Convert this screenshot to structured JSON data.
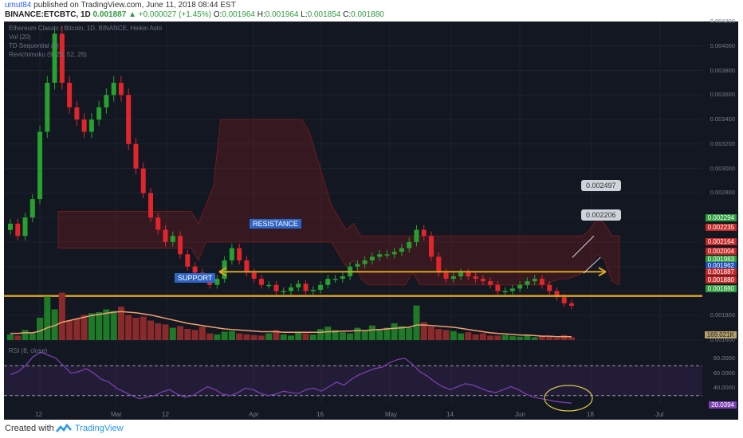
{
  "header": {
    "user": "umut84",
    "published": "published on TradingView.com, June 11, 2018 08:44 EST",
    "symbol": "BINANCE:ETCBTC, 1D",
    "price": "0.001887",
    "change": "▲ +0.000027 (+1.45%)",
    "o_label": "O:",
    "o": "0.001964",
    "h_label": "H:",
    "h": "0.001964",
    "l_label": "L:",
    "l": "0.001854",
    "c_label": "C:",
    "c": "0.001880"
  },
  "indicators": {
    "title": "Ethereum Classic / Bitcoin, 1D, BINANCE, Heikin Ashi",
    "vol": "Vol (20)",
    "td": "TD Sequential (0)",
    "ichimoku": "Revichimoku (9, 26, 52, 26)",
    "rsi": "RSI (8, close)"
  },
  "annotations": {
    "resistance": "RESISTANCE",
    "support": "SUPPORT",
    "callout1": "0.002497",
    "callout2": "0.002206"
  },
  "axis": {
    "price_labels": [
      "0.004200",
      "0.004000",
      "0.003800",
      "0.003600",
      "0.003400",
      "0.003200",
      "0.003000",
      "0.002800",
      "0.002600",
      "0.002400",
      "0.002200",
      "0.002000",
      "0.001800",
      "0.001600"
    ],
    "x_labels": [
      "12",
      "Mar",
      "12",
      "Apr",
      "16",
      "May",
      "14",
      "Jun",
      "18",
      "Jul"
    ],
    "rsi_labels": [
      "80.0000",
      "60.0000",
      "40.0000"
    ]
  },
  "price_tags": [
    {
      "text": "0.002294",
      "color": "#2e9e3e"
    },
    {
      "text": "0.002235",
      "color": "#c62828"
    },
    {
      "text": "0.002164",
      "color": "#c62828"
    },
    {
      "text": "0.002004",
      "color": "#c62828"
    },
    {
      "text": "0.001983",
      "color": "#2e9e3e"
    },
    {
      "text": "0.001962",
      "color": "#1e4fb5"
    },
    {
      "text": "0.001887",
      "color": "#c62828"
    },
    {
      "text": "0.001880",
      "color": "#c62828"
    },
    {
      "text": "0.001880",
      "color": "#2e9e3e"
    }
  ],
  "volume_tag": "169.021K",
  "rsi_tag": "20.0394",
  "footer": {
    "created_with": "Created with",
    "brand": "TradingView"
  },
  "colors": {
    "up": "#26a12f",
    "down": "#e0252b",
    "background": "#131722",
    "support_line": "#d9a21e",
    "rsi_line": "#7b3fb0",
    "volume_ma": "#f0a070"
  },
  "chart_data": {
    "type": "candlestick",
    "title": "Ethereum Classic / Bitcoin, 1D, BINANCE, Heikin Ashi",
    "ylim": [
      0.0016,
      0.0042
    ],
    "x_ticks": [
      "12",
      "Mar",
      "12",
      "Apr",
      "16",
      "May",
      "14",
      "Jun",
      "18",
      "Jul"
    ],
    "close": [
      0.00255,
      0.00245,
      0.0026,
      0.00275,
      0.0033,
      0.0037,
      0.0041,
      0.0037,
      0.0035,
      0.0034,
      0.0033,
      0.0034,
      0.0035,
      0.0036,
      0.0037,
      0.0036,
      0.0032,
      0.003,
      0.0028,
      0.0026,
      0.0025,
      0.0024,
      0.00245,
      0.0023,
      0.0022,
      0.00215,
      0.0021,
      0.00205,
      0.0021,
      0.00225,
      0.00235,
      0.00225,
      0.00215,
      0.0021,
      0.00205,
      0.00205,
      0.002,
      0.002,
      0.00203,
      0.00206,
      0.002,
      0.00201,
      0.00205,
      0.0021,
      0.0021,
      0.00212,
      0.0022,
      0.00222,
      0.00225,
      0.00228,
      0.0023,
      0.0023,
      0.00232,
      0.00235,
      0.0024,
      0.0025,
      0.00245,
      0.00228,
      0.00215,
      0.0021,
      0.00212,
      0.00215,
      0.00212,
      0.0021,
      0.00208,
      0.00205,
      0.002,
      0.002,
      0.00202,
      0.00205,
      0.00208,
      0.0021,
      0.00205,
      0.002,
      0.00195,
      0.0019,
      0.00188
    ],
    "volume_levels": [
      0.1,
      0.08,
      0.18,
      0.12,
      0.4,
      0.78,
      0.55,
      0.85,
      0.35,
      0.38,
      0.45,
      0.48,
      0.5,
      0.55,
      0.52,
      0.6,
      0.45,
      0.4,
      0.42,
      0.35,
      0.3,
      0.28,
      0.22,
      0.25,
      0.2,
      0.18,
      0.24,
      0.12,
      0.1,
      0.15,
      0.16,
      0.12,
      0.1,
      0.09,
      0.08,
      0.12,
      0.18,
      0.1,
      0.08,
      0.14,
      0.12,
      0.1,
      0.2,
      0.24,
      0.18,
      0.14,
      0.12,
      0.22,
      0.16,
      0.26,
      0.2,
      0.22,
      0.3,
      0.25,
      0.22,
      0.62,
      0.32,
      0.24,
      0.2,
      0.18,
      0.16,
      0.12,
      0.14,
      0.1,
      0.12,
      0.08,
      0.08,
      0.09,
      0.07,
      0.06,
      0.08,
      0.05,
      0.07,
      0.06,
      0.04,
      0.09,
      0.05
    ],
    "volume_ma": [
      0.12,
      0.12,
      0.13,
      0.13,
      0.16,
      0.22,
      0.26,
      0.32,
      0.35,
      0.38,
      0.41,
      0.44,
      0.46,
      0.48,
      0.5,
      0.51,
      0.5,
      0.49,
      0.47,
      0.45,
      0.42,
      0.39,
      0.36,
      0.33,
      0.3,
      0.28,
      0.26,
      0.24,
      0.22,
      0.2,
      0.19,
      0.18,
      0.17,
      0.16,
      0.15,
      0.15,
      0.15,
      0.14,
      0.14,
      0.14,
      0.14,
      0.14,
      0.14,
      0.15,
      0.15,
      0.16,
      0.16,
      0.17,
      0.17,
      0.18,
      0.19,
      0.2,
      0.21,
      0.22,
      0.23,
      0.27,
      0.27,
      0.26,
      0.25,
      0.24,
      0.23,
      0.21,
      0.19,
      0.17,
      0.15,
      0.13,
      0.12,
      0.11,
      0.1,
      0.09,
      0.09,
      0.08,
      0.07,
      0.07,
      0.06,
      0.06,
      0.06
    ],
    "rsi": [
      58,
      62,
      70,
      82,
      88,
      84,
      80,
      70,
      60,
      62,
      66,
      60,
      52,
      48,
      40,
      35,
      30,
      26,
      28,
      30,
      35,
      38,
      32,
      28,
      30,
      36,
      42,
      38,
      32,
      30,
      34,
      40,
      38,
      33,
      30,
      32,
      36,
      34,
      33,
      38,
      40,
      36,
      42,
      48,
      44,
      52,
      58,
      62,
      66,
      68,
      74,
      78,
      80,
      72,
      62,
      56,
      48,
      42,
      38,
      42,
      46,
      44,
      40,
      36,
      34,
      38,
      42,
      38,
      32,
      28,
      26,
      24,
      22,
      21,
      20
    ],
    "rsi_levels": [
      70,
      30
    ],
    "support": 0.00196,
    "resistance": 0.00206
  }
}
